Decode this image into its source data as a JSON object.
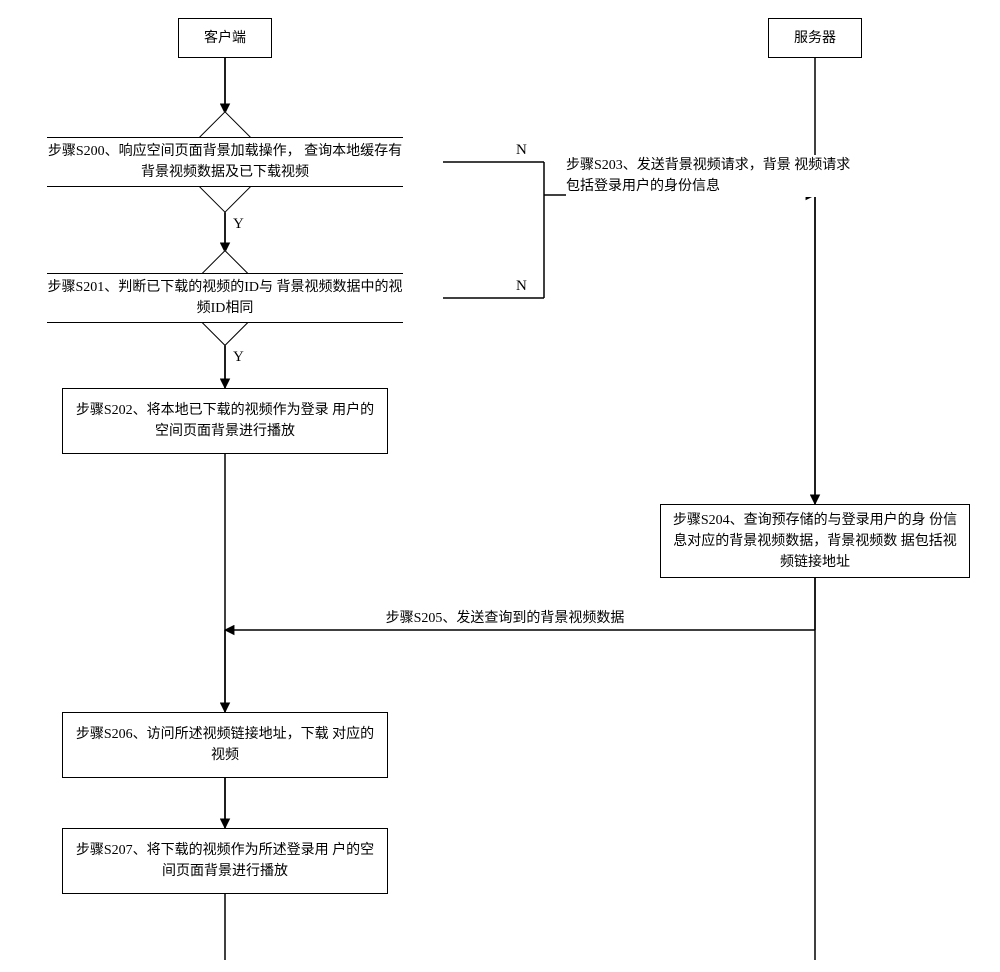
{
  "lanes": {
    "client": "客户端",
    "server": "服务器"
  },
  "steps": {
    "s200": "步骤S200、响应空间页面背景加载操作，\n查询本地缓存有背景视频数据及已下载视频",
    "s201": "步骤S201、判断已下载的视频的ID与\n背景视频数据中的视频ID相同",
    "s202": "步骤S202、将本地已下载的视频作为登录\n用户的空间页面背景进行播放",
    "s203": "步骤S203、发送背景视频请求，背景\n视频请求包括登录用户的身份信息",
    "s204": "步骤S204、查询预存储的与登录用户的身\n份信息对应的背景视频数据，背景视频数\n据包括视频链接地址",
    "s205": "步骤S205、发送查询到的背景视频数据",
    "s206": "步骤S206、访问所述视频链接地址，下载\n对应的视频",
    "s207": "步骤S207、将下载的视频作为所述登录用\n户的空间页面背景进行播放"
  },
  "branches": {
    "yes": "Y",
    "no": "N"
  },
  "chart_data": {
    "type": "flowchart",
    "lanes": [
      "客户端",
      "服务器"
    ],
    "nodes": [
      {
        "id": "client_head",
        "lane": "客户端",
        "shape": "rect",
        "label": "客户端"
      },
      {
        "id": "server_head",
        "lane": "服务器",
        "shape": "rect",
        "label": "服务器"
      },
      {
        "id": "S200",
        "lane": "客户端",
        "shape": "decision",
        "label": "步骤S200、响应空间页面背景加载操作，查询本地缓存有背景视频数据及已下载视频"
      },
      {
        "id": "S201",
        "lane": "客户端",
        "shape": "decision",
        "label": "步骤S201、判断已下载的视频的ID与背景视频数据中的视频ID相同"
      },
      {
        "id": "S202",
        "lane": "客户端",
        "shape": "process",
        "label": "步骤S202、将本地已下载的视频作为登录用户的空间页面背景进行播放"
      },
      {
        "id": "S203",
        "lane": "消息",
        "shape": "message",
        "label": "步骤S203、发送背景视频请求，背景视频请求包括登录用户的身份信息"
      },
      {
        "id": "S204",
        "lane": "服务器",
        "shape": "process",
        "label": "步骤S204、查询预存储的与登录用户的身份信息对应的背景视频数据，背景视频数据包括视频链接地址"
      },
      {
        "id": "S205",
        "lane": "消息",
        "shape": "message",
        "label": "步骤S205、发送查询到的背景视频数据"
      },
      {
        "id": "S206",
        "lane": "客户端",
        "shape": "process",
        "label": "步骤S206、访问所述视频链接地址，下载对应的视频"
      },
      {
        "id": "S207",
        "lane": "客户端",
        "shape": "process",
        "label": "步骤S207、将下载的视频作为所述登录用户的空间页面背景进行播放"
      }
    ],
    "edges": [
      {
        "from": "client_head",
        "to": "S200"
      },
      {
        "from": "S200",
        "to": "S201",
        "label": "Y"
      },
      {
        "from": "S200",
        "to": "S203",
        "label": "N",
        "type": "message_to_server"
      },
      {
        "from": "S201",
        "to": "S202",
        "label": "Y"
      },
      {
        "from": "S201",
        "to": "S203",
        "label": "N",
        "type": "message_to_server"
      },
      {
        "from": "S203",
        "to": "S204"
      },
      {
        "from": "S204",
        "to": "S205"
      },
      {
        "from": "S205",
        "to": "S206",
        "type": "message_to_client"
      },
      {
        "from": "S206",
        "to": "S207"
      },
      {
        "from": "S202",
        "to": "client_lifeline"
      },
      {
        "from": "S207",
        "to": "client_lifeline"
      }
    ]
  }
}
